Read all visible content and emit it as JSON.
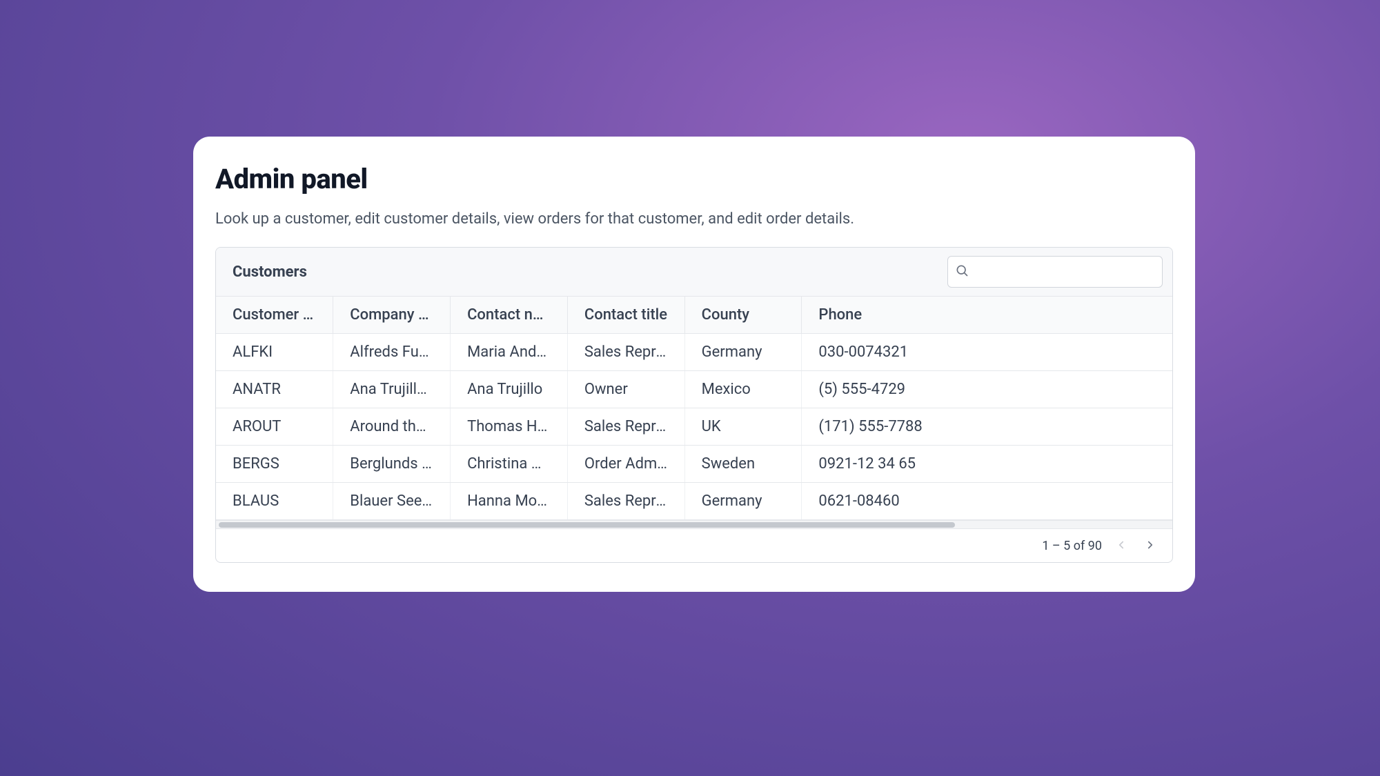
{
  "page": {
    "title": "Admin panel",
    "subtitle": "Look up a customer, edit customer details, view orders for that customer, and edit order details."
  },
  "grid": {
    "title": "Customers",
    "search": {
      "placeholder": "",
      "value": ""
    },
    "columns": [
      "Customer ID",
      "Company name",
      "Contact name",
      "Contact title",
      "County",
      "Phone"
    ],
    "rows": [
      {
        "id": "ALFKI",
        "company": "Alfreds Futterkiste",
        "contact": "Maria Anders",
        "title": "Sales Representative",
        "county": "Germany",
        "phone": "030-0074321"
      },
      {
        "id": "ANATR",
        "company": "Ana Trujillo Emparedados y helados",
        "contact": "Ana Trujillo",
        "title": "Owner",
        "county": "Mexico",
        "phone": "(5) 555-4729"
      },
      {
        "id": "AROUT",
        "company": "Around the Horn",
        "contact": "Thomas Hardy",
        "title": "Sales Representative",
        "county": "UK",
        "phone": "(171) 555-7788"
      },
      {
        "id": "BERGS",
        "company": "Berglunds snabbköp",
        "contact": "Christina Berglund",
        "title": "Order Administrator",
        "county": "Sweden",
        "phone": "0921-12 34 65"
      },
      {
        "id": "BLAUS",
        "company": "Blauer See Delikatessen",
        "contact": "Hanna Moos",
        "title": "Sales Representative",
        "county": "Germany",
        "phone": "0621-08460"
      }
    ],
    "pagination": {
      "range": "1 – 5 of 90"
    }
  },
  "col_widths": [
    "12.25%",
    "12.25%",
    "12.25%",
    "12.25%",
    "12.25%",
    "38.75%"
  ]
}
